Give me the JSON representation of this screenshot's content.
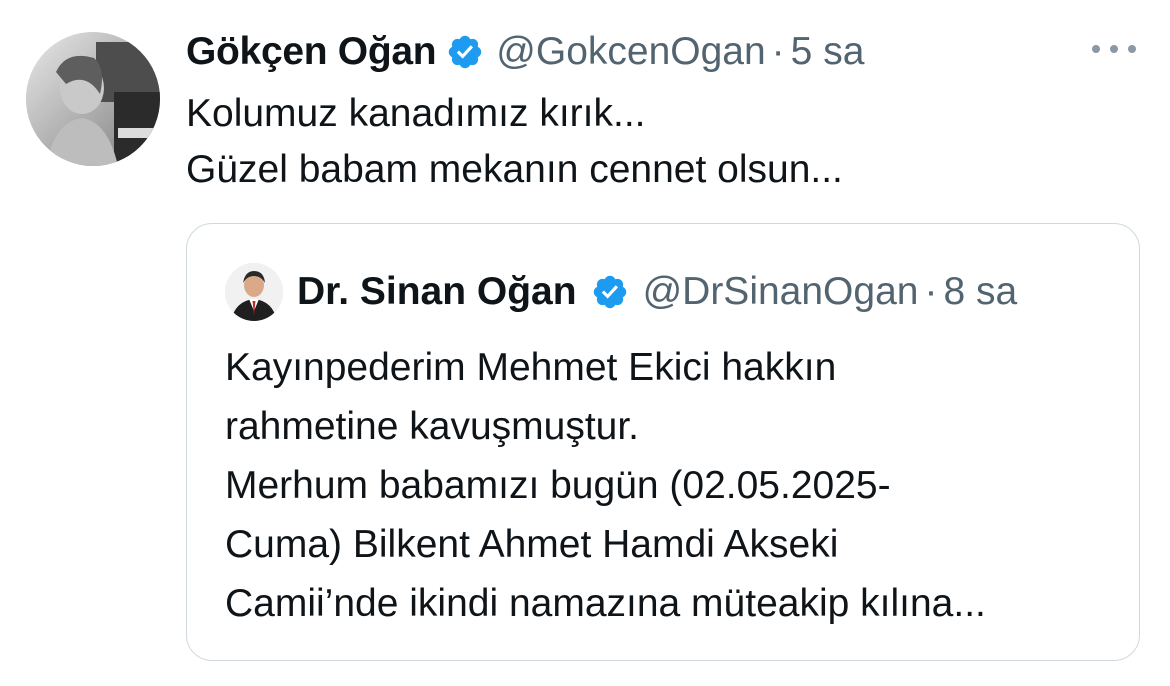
{
  "tweet": {
    "author_name": "Gökçen Oğan",
    "author_handle": "@GokcenOgan",
    "separator": "·",
    "time": "5 sa",
    "text_lines": [
      "Kolumuz kanadımız kırık...",
      "Güzel babam mekanın cennet olsun..."
    ],
    "verified_icon": "verified-badge-icon",
    "more_icon": "more-options-icon"
  },
  "quoted": {
    "author_name": "Dr. Sinan Oğan",
    "author_handle": "@DrSinanOgan",
    "separator": "·",
    "time": "8 sa",
    "text_lines": [
      "Kayınpederim Mehmet Ekici hakkın",
      "rahmetine kavuşmuştur.",
      "Merhum babamızı bugün (02.05.2025-",
      "Cuma) Bilkent Ahmet Hamdi Akseki",
      "Camii’nde ikindi namazına müteakip kılına..."
    ]
  },
  "colors": {
    "text_primary": "#0f1419",
    "text_secondary": "#536471",
    "verified_blue": "#1d9bf0",
    "border": "#cfd9de"
  }
}
